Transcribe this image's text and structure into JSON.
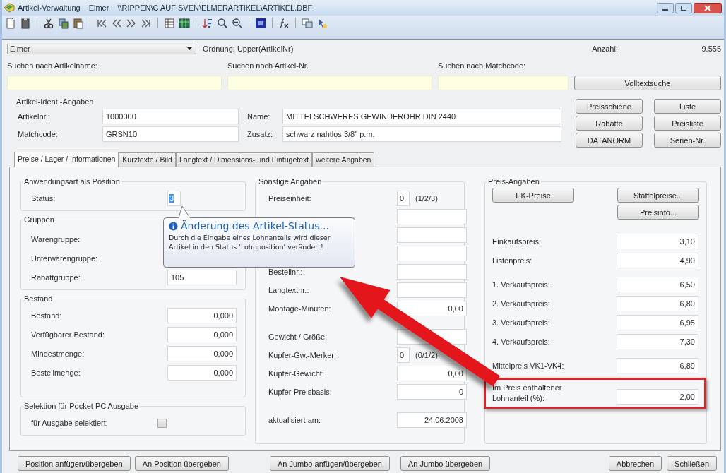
{
  "window": {
    "title": [
      "Artikel-Verwaltung",
      "Elmer",
      "\\\\RIPPEN\\C AUF SVEN\\ELMERARTIKEL\\ARTIKEL.DBF"
    ]
  },
  "header": {
    "combo": "Elmer",
    "order": "Ordnung: Upper(ArtikelNr)",
    "count_label": "Anzahl:",
    "count": "9.555"
  },
  "search": [
    {
      "label": "Suchen nach Artikelname:"
    },
    {
      "label": "Suchen nach Artikel-Nr."
    },
    {
      "label": "Suchen nach Matchcode:"
    }
  ],
  "fulltext_button": "Volltextsuche",
  "ident": {
    "title": "Artikel-Ident.-Angaben",
    "rows": [
      {
        "label": "Artikelnr.:",
        "value": "1000000",
        "label2": "Name:",
        "value2": "MITTELSCHWERES GEWINDEROHR DIN 2440"
      },
      {
        "label": "Matchcode:",
        "value": "GRSN10",
        "label2": "Zusatz:",
        "value2": "schwarz nahtlos 3/8\"    p.m."
      }
    ]
  },
  "side_buttons": [
    "Preisschiene",
    "Liste",
    "Rabatte",
    "Preisliste",
    "DATANORM",
    "Serien-Nr."
  ],
  "tabs": [
    {
      "label": "Preise / Lager / Informationen",
      "selected": true
    },
    {
      "label": "Kurztexte / Bild",
      "selected": false
    },
    {
      "label": "Langtext / Dimensions- und Einfügetext",
      "selected": false
    },
    {
      "label": "weitere Angaben",
      "selected": false
    }
  ],
  "left": [
    {
      "title": "Anwendungsart als Position",
      "rows": [
        {
          "kind": "short",
          "label": "Status:",
          "value": "3",
          "highlighted": true
        }
      ]
    },
    {
      "title": "Gruppen",
      "rows": [
        {
          "kind": "covered",
          "label": "Warengruppe:"
        },
        {
          "kind": "covered",
          "label": "Unterwarengruppe:"
        },
        {
          "kind": "text",
          "label": "Rabattgruppe:",
          "value": "105"
        }
      ]
    },
    {
      "title": "Bestand",
      "rows": [
        {
          "kind": "number",
          "label": "Bestand:",
          "value": "0,000"
        },
        {
          "kind": "number",
          "label": "Verfügbarer Bestand:",
          "value": "0,000"
        },
        {
          "kind": "number",
          "label": "Mindestmenge:",
          "value": "0,000"
        },
        {
          "kind": "number",
          "label": "Bestellmenge:",
          "value": "0,000"
        }
      ]
    },
    {
      "title": "Selektion für Pocket PC Ausgabe",
      "rows": [
        {
          "kind": "check",
          "label": "für Ausgabe selektiert:",
          "checked": false
        }
      ]
    }
  ],
  "middle": {
    "title": "Sonstige Angaben",
    "blocks": [
      [
        {
          "kind": "unit",
          "label": "Preiseinheit:",
          "value": "0",
          "hint": "(1/2/3)"
        },
        {
          "kind": "field_only"
        },
        {
          "kind": "field_only"
        },
        {
          "kind": "field_only"
        },
        {
          "kind": "text",
          "label": "Bestellnr.:"
        },
        {
          "kind": "text",
          "label": "Langtextnr.:"
        },
        {
          "kind": "number",
          "label": "Montage-Minuten:",
          "value": "0,00"
        }
      ],
      [
        {
          "kind": "text",
          "label": "Gewicht / Größe:"
        },
        {
          "kind": "unit",
          "label": "Kupfer-Gw.-Merker:",
          "value": "0",
          "hint": "(0/1/2)"
        },
        {
          "kind": "number",
          "label": "Kupfer-Gewicht:",
          "value": "0,00"
        },
        {
          "kind": "number",
          "label": "Kupfer-Preisbasis:",
          "value": "0"
        }
      ],
      [
        {
          "kind": "number",
          "label": "aktualisiert am:",
          "value": "24.06.2008"
        }
      ]
    ]
  },
  "right": {
    "title": "Preis-Angaben",
    "buttons_left": [
      "EK-Preise"
    ],
    "buttons_right": [
      "Staffelpreise...",
      "Preisinfo..."
    ],
    "blocks": [
      [
        {
          "label": "Einkaufspreis:",
          "value": "3,10",
          "highlighted": false
        },
        {
          "label": "Listenpreis:",
          "value": "4,90",
          "highlighted": false
        }
      ],
      [
        {
          "label": "1. Verkaufspreis:",
          "value": "6,50",
          "highlighted": false
        },
        {
          "label": "2. Verkaufspreis:",
          "value": "6,80",
          "highlighted": false
        },
        {
          "label": "3. Verkaufspreis:",
          "value": "6,95",
          "highlighted": false
        },
        {
          "label": "4. Verkaufspreis:",
          "value": "7,30",
          "highlighted": false
        }
      ],
      [
        {
          "label": "Mittelpreis VK1-VK4:",
          "value": "6,89",
          "highlighted": false
        }
      ],
      [
        {
          "label": "Im Preis enthaltener Lohnanteil (%):",
          "value": "2,00",
          "highlighted": true
        }
      ]
    ]
  },
  "tooltip": {
    "title": "Änderung des Artikel-Status...",
    "text": "Durch die Eingabe eines Lohnanteils wird dieser Artikel in den Status 'Lohnposition' verändert!"
  },
  "bottom_buttons": {
    "left": [
      "Position anfügen/übergeben",
      "An Position übergeben"
    ],
    "center": [
      "An Jumbo anfügen/übergeben",
      "An Jumbo übergeben"
    ],
    "right": [
      "Abbrechen",
      "Schließen"
    ]
  }
}
